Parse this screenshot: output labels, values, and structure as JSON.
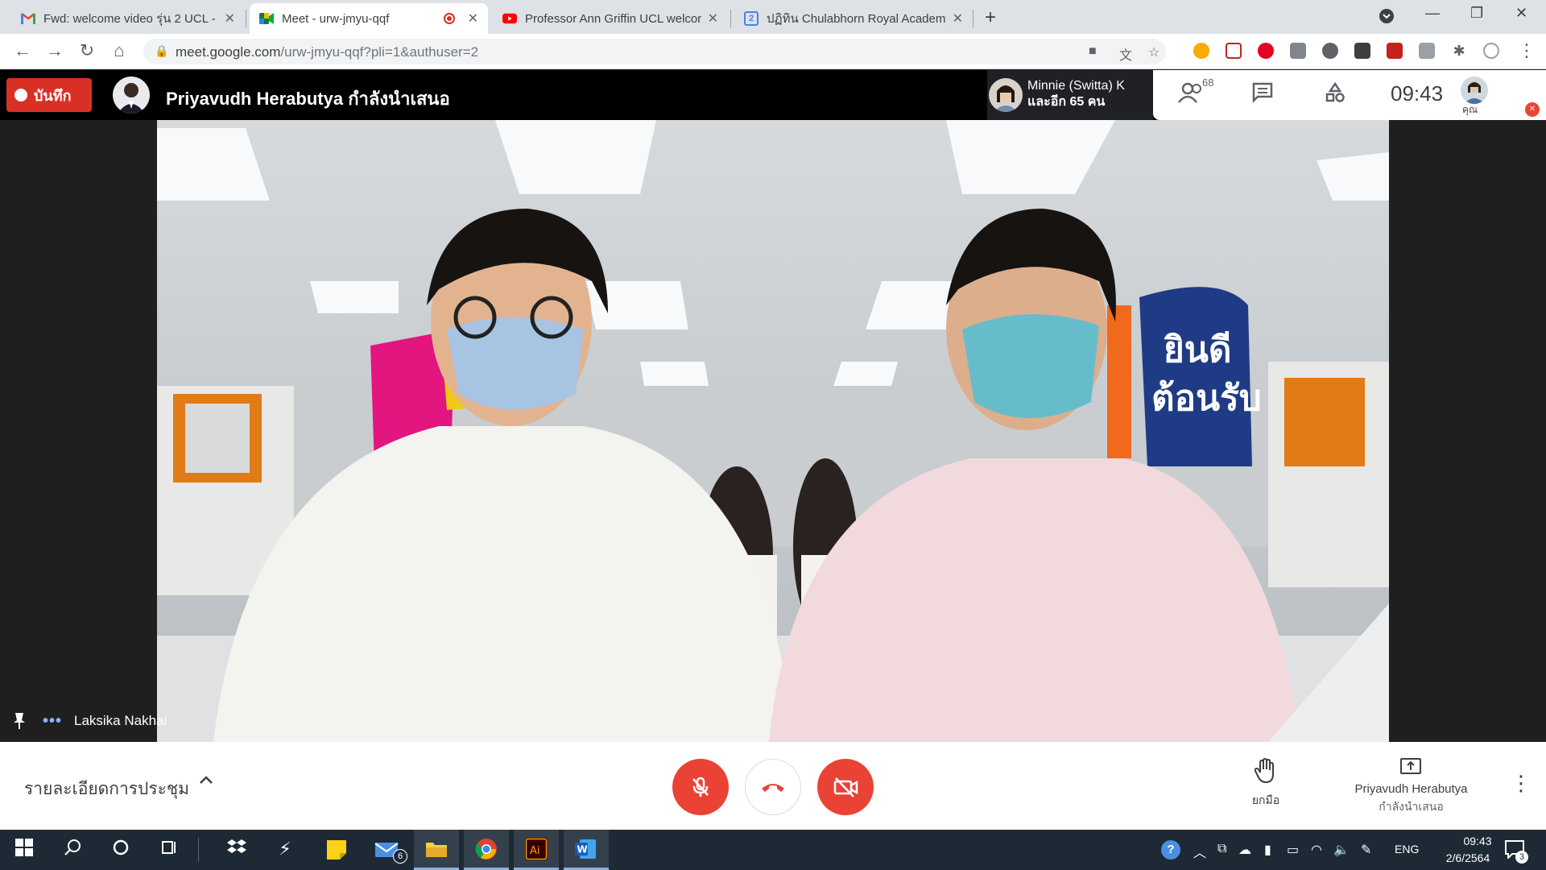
{
  "browser": {
    "tabs": [
      {
        "title": "Fwd: welcome video รุ่น 2 UCL - k",
        "icon": "gmail-icon"
      },
      {
        "title": "Meet - urw-jmyu-qqf",
        "icon": "meet-icon"
      },
      {
        "title": "Professor Ann Griffin UCL welcon",
        "icon": "youtube-icon"
      },
      {
        "title": "ปฏิทิน Chulabhorn Royal Academy",
        "icon": "calendar-icon"
      }
    ],
    "calendar_favicon_number": "2",
    "url_host": "meet.google.com",
    "url_path": "/urw-jmyu-qqf?pli=1&authuser=2"
  },
  "meet": {
    "record_label": "บันทึก",
    "presenter_title": "Priyavudh Herabutya กำลังนำเสนอ",
    "participant_line1": "Minnie (Switta) K",
    "participant_line2": "และอีก 65 คน",
    "people_count": "68",
    "clock": "09:43",
    "you_label": "คุณ",
    "video_banner_text_1": "ยินดี",
    "video_banner_text_2": "ต้อนรับ",
    "self_name": "Laksika Nakhai",
    "meeting_details": "รายละเอียดการประชุม",
    "raise_hand_label": "ยกมือ",
    "presenter_name": "Priyavudh Herabutya",
    "presenting_label": "กำลังนำเสนอ"
  },
  "taskbar": {
    "mail_badge": "6",
    "lang": "ENG",
    "time": "09:43",
    "date": "2/6/2564",
    "notif_count": "3"
  },
  "colors": {
    "meet_red": "#ea4335",
    "record_red": "#d93025",
    "taskbar_bg": "#1d2a36",
    "tab_strip": "#dee1e6"
  }
}
